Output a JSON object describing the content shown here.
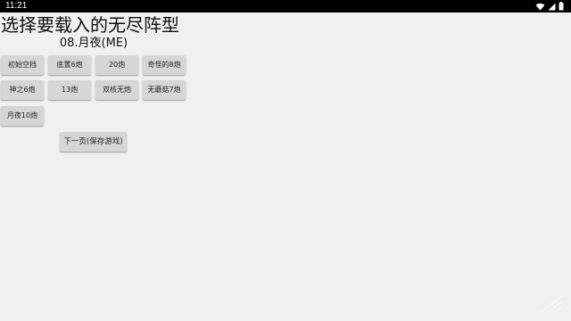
{
  "status_bar": {
    "time": "11:21",
    "icons": [
      "wifi-icon",
      "signal-icon",
      "battery-icon"
    ],
    "background": "#000000"
  },
  "header": {
    "title": "选择要载入的无尽阵型",
    "subtitle": "08.月夜(ME)"
  },
  "formations": [
    "初始空挡",
    "底置6炮",
    "20炮",
    "奇怪的8炮",
    "神之6炮",
    "13炮",
    "双核无炮",
    "无蘑菇7炮",
    "月夜10炮"
  ],
  "actions": {
    "next_page_label": "下一页(保存游戏)"
  },
  "colors": {
    "background": "#f0f0f0",
    "button": "#d6d6d6",
    "text": "#222222"
  }
}
